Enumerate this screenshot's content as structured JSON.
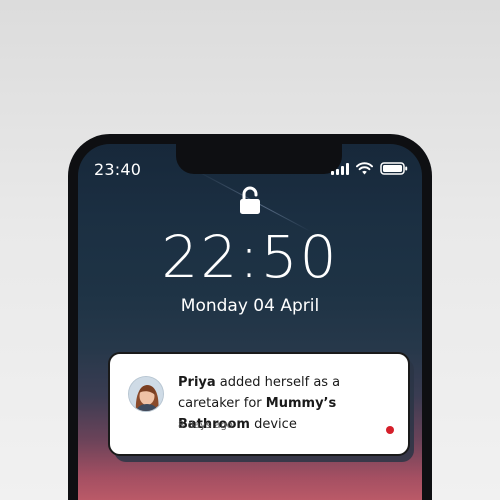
{
  "status_bar": {
    "time": "23:40",
    "icons": [
      "cellular-signal-icon",
      "wifi-icon",
      "battery-icon"
    ]
  },
  "lock_screen": {
    "lock_icon": "unlocked-padlock-icon",
    "clock": "22:50",
    "date": "Monday 04 April"
  },
  "notification": {
    "avatar_icon": "user-avatar",
    "actor": "Priya",
    "action_text": " added herself as a caretaker for ",
    "device_name": "Mummy’s Bathroom",
    "suffix": " device",
    "timestamp": "8 days ago",
    "unread": true,
    "unread_color": "#d51f2a"
  },
  "colors": {
    "frame": "#0e0f12",
    "wallpaper_top": "#17283a",
    "wallpaper_bottom": "#c8606b"
  }
}
